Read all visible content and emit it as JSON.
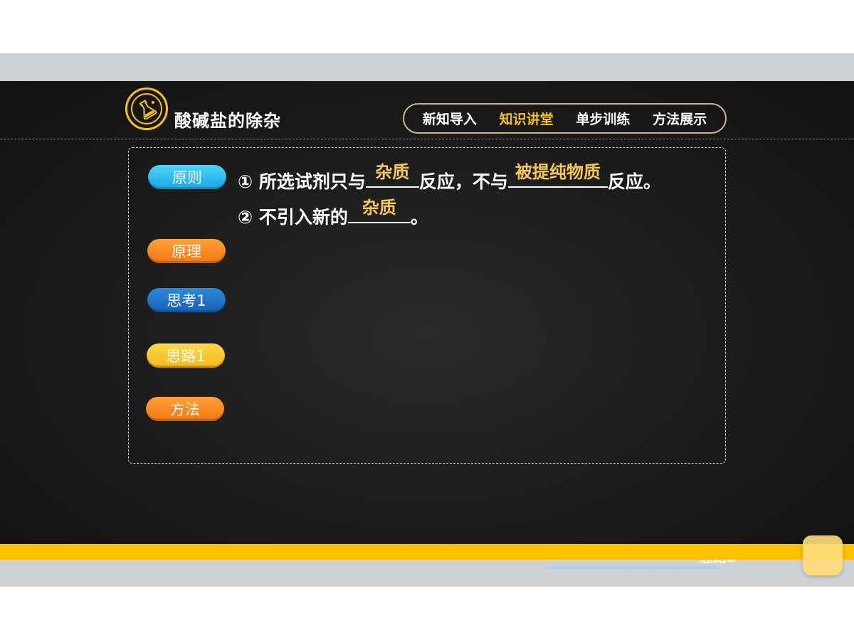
{
  "header": {
    "title": "酸碱盐的除杂",
    "nav": [
      "新知导入",
      "知识讲堂",
      "单步训练",
      "方法展示"
    ],
    "active_nav": "知识讲堂"
  },
  "sidebar": {
    "buttons": [
      {
        "label": "原则",
        "color": "#1aa7e6"
      },
      {
        "label": "原理",
        "color": "#f2760f"
      },
      {
        "label": "思考1",
        "color": "#1661b5"
      },
      {
        "label": "思路1",
        "color": "#f6b91a"
      },
      {
        "label": "方法",
        "color": "#f2760f"
      }
    ]
  },
  "content": {
    "line1": {
      "prefix": "① 所选试剂只与",
      "answer1": "杂质",
      "middle": "反应，不与",
      "answer2": "被提纯物质",
      "suffix": "反应。"
    },
    "line2": {
      "prefix": "② 不引入新的",
      "answer": "杂质",
      "suffix": "。"
    }
  },
  "footer": {
    "next_label": "思路2",
    "chevrons": "»»»»»»»»»»»»»»»»»»»»»»»»»»»»»»»»»»»»»»"
  },
  "colors": {
    "accent_yellow": "#ffc000",
    "answer_text": "#f6c85a",
    "board": "#1b1b1b"
  }
}
